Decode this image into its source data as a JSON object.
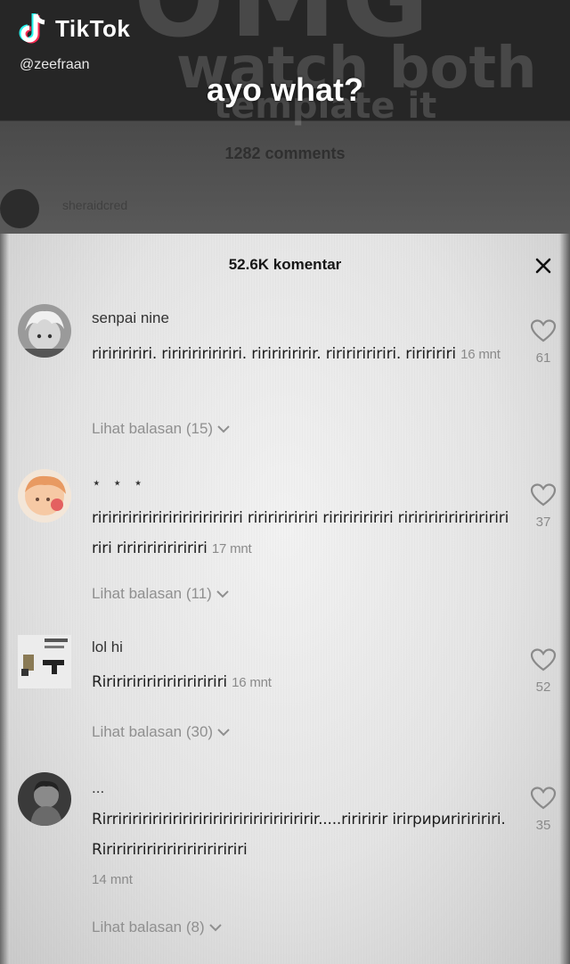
{
  "video": {
    "app_name": "TikTok",
    "handle": "@zeefraan",
    "caption": "ayo what?",
    "background_text": [
      "OMG",
      "watch both",
      "template it"
    ],
    "old_comment_count": "1282 comments",
    "faded_username": "sheraidcred"
  },
  "sheet": {
    "title": "52.6K komentar",
    "close_label": "✕"
  },
  "comments": [
    {
      "username": "senpai nine",
      "text": "riririririri. riririririririri. ririririririr. ririririririri. ririririri",
      "time": "16 mnt",
      "replies_label": "Lihat balasan (15)",
      "likes": "61",
      "avatar_color": "#7a7a7a"
    },
    {
      "username": "⋆ ⋆ ⋆",
      "text": "ririririririririririririririri ririririririri ririririririri ririririririririririri riri ririririririririri",
      "time": "17 mnt",
      "replies_label": "Lihat balasan (11)",
      "likes": "37",
      "avatar_color": "#e8b48a"
    },
    {
      "username": "lol hi",
      "text": "Ririririririririririririri",
      "time": "16 mnt",
      "replies_label": "Lihat balasan (30)",
      "likes": "52",
      "avatar_color": "#dcdcdc"
    },
    {
      "username": "...",
      "text": "Rirririririririririririririririririririririr.....ririririr irirририririririri. Ririririririririririririririri",
      "time": "14 mnt",
      "replies_label": "Lihat balasan (8)",
      "likes": "35",
      "avatar_color": "#5a5a5a"
    }
  ],
  "colors": {
    "sheet_bg": "#ececec",
    "text": "#1d1d1d",
    "muted": "#8a8a8a"
  }
}
